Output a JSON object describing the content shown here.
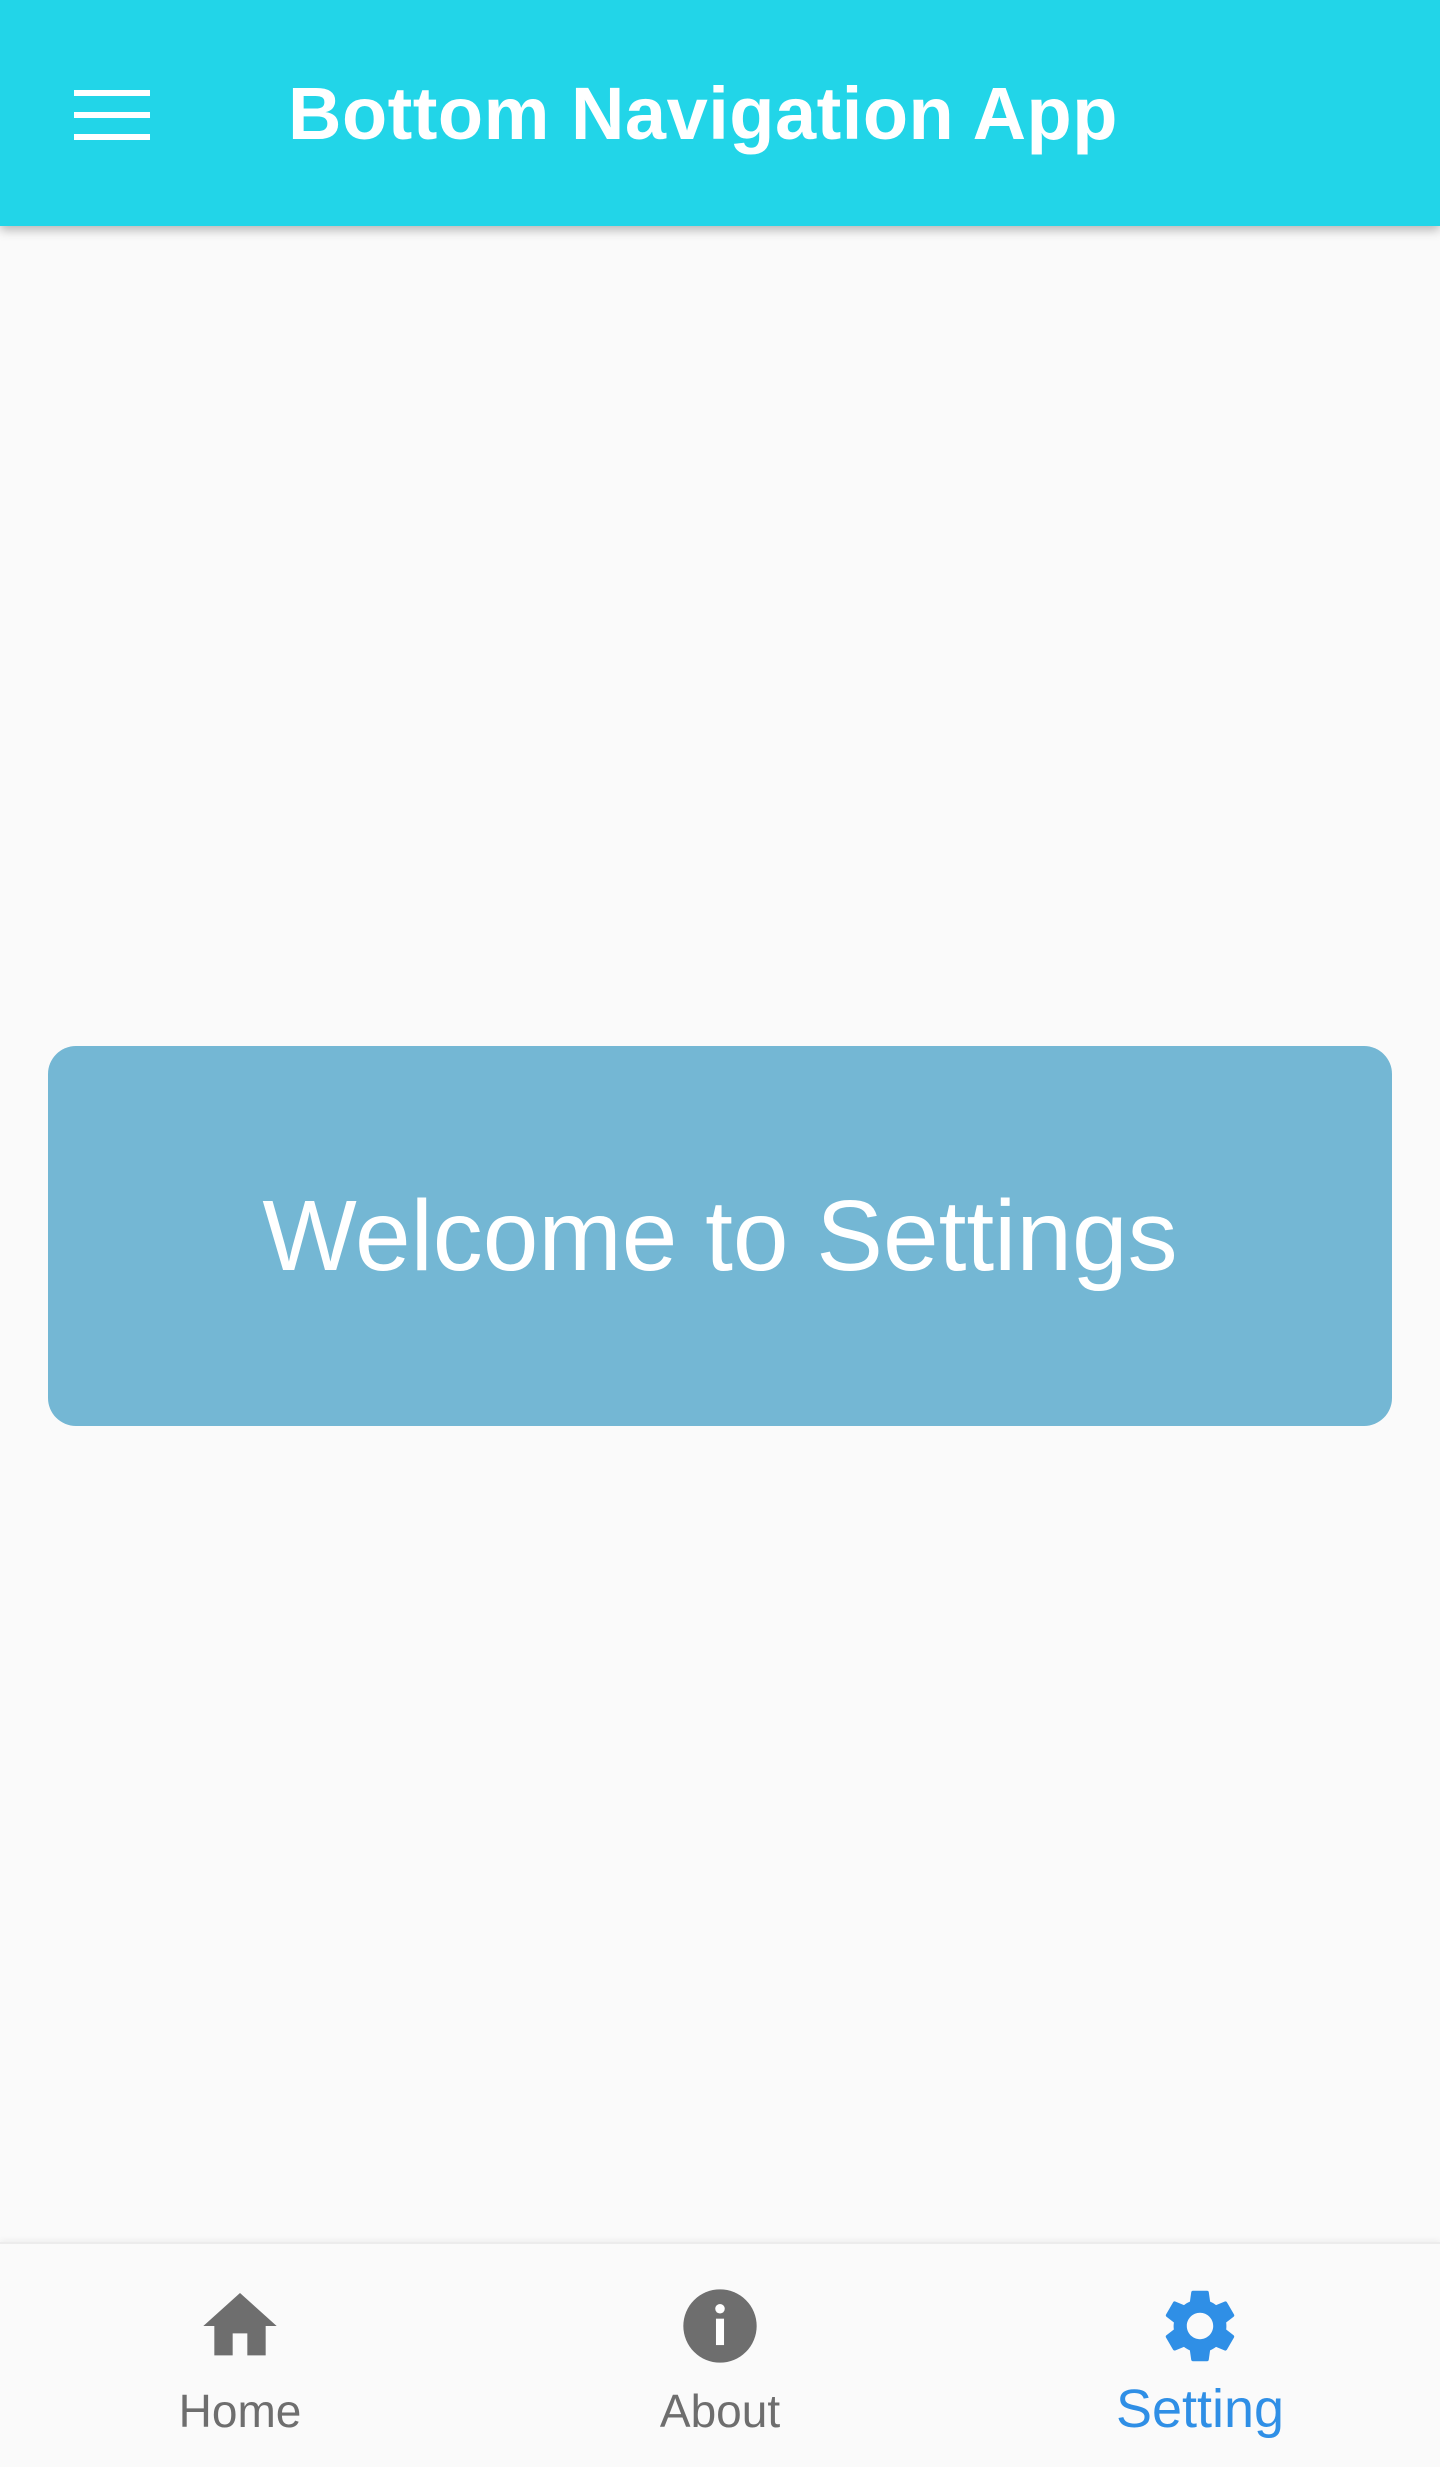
{
  "app_bar": {
    "title": "Bottom Navigation App",
    "menu_icon": "hamburger-menu-icon",
    "background_color": "#22d5e8"
  },
  "main": {
    "welcome_text": "Welcome to Settings",
    "card_color": "#74b7d4"
  },
  "bottom_nav": {
    "items": [
      {
        "label": "Home",
        "icon": "home-icon",
        "active": false
      },
      {
        "label": "About",
        "icon": "info-icon",
        "active": false
      },
      {
        "label": "Setting",
        "icon": "gear-icon",
        "active": true
      }
    ],
    "active_color": "#2f8fe6",
    "inactive_color": "#6e6e6e"
  }
}
